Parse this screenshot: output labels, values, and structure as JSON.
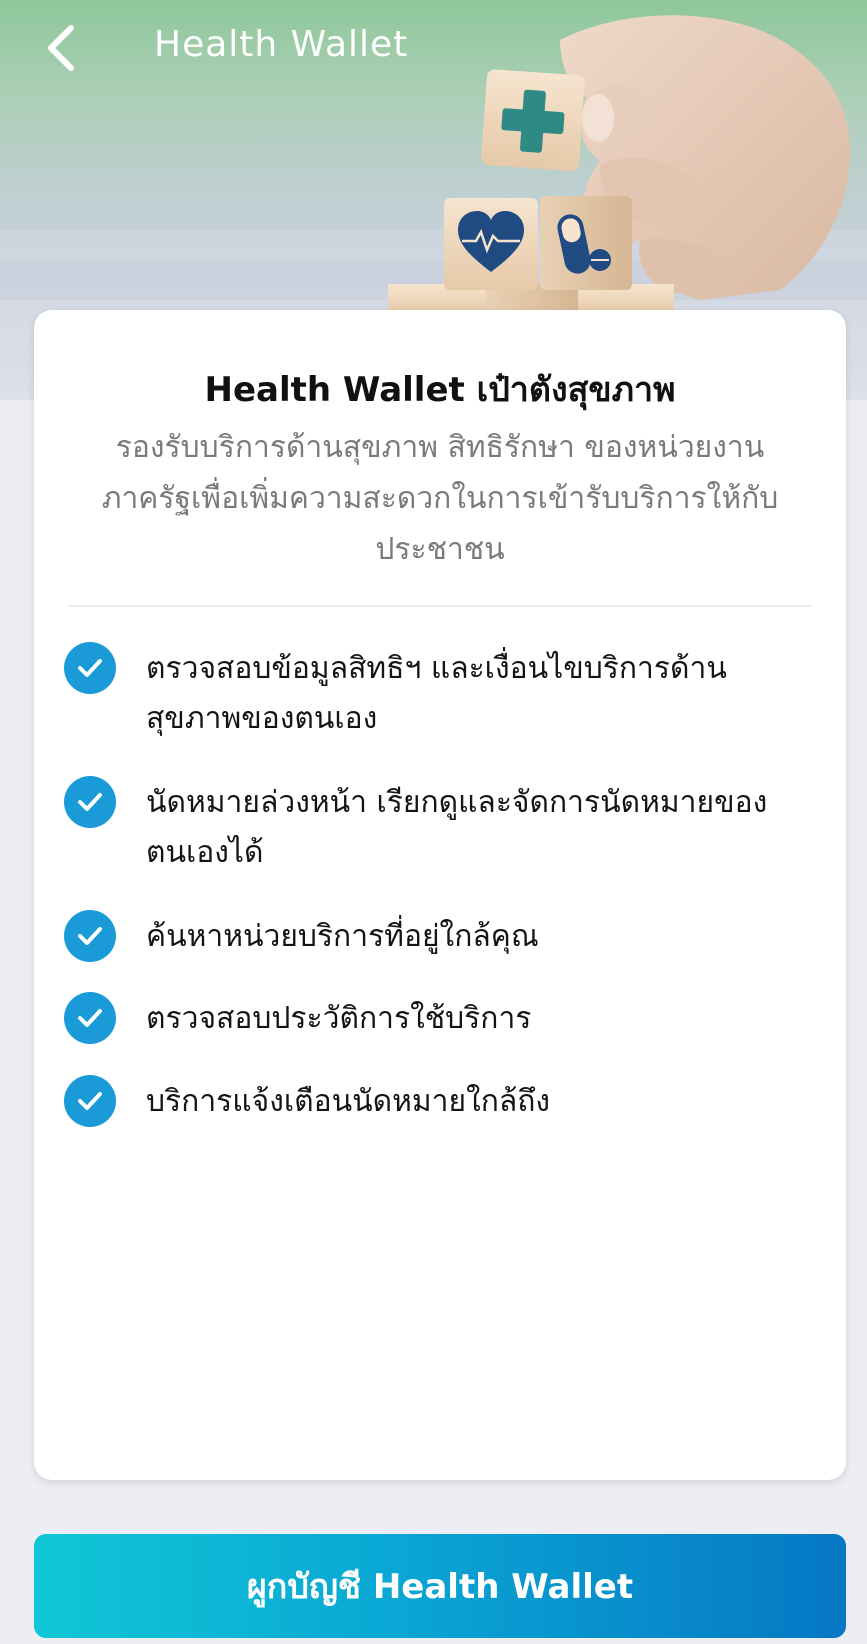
{
  "header": {
    "title": "Health Wallet",
    "back_icon": "chevron-left-icon"
  },
  "card": {
    "title": "Health Wallet เป๋าตังสุขภาพ",
    "description": "รองรับบริการด้านสุขภาพ สิทธิรักษา ของหน่วยงานภาครัฐเพื่อเพิ่มความสะดวกในการเข้ารับบริการให้กับประชาชน",
    "features": [
      {
        "icon": "check-circle-icon",
        "text": "ตรวจสอบข้อมูลสิทธิฯ และเงื่อนไขบริการด้านสุขภาพของตนเอง"
      },
      {
        "icon": "check-circle-icon",
        "text": "นัดหมายล่วงหน้า เรียกดูและจัดการนัดหมายของตนเองได้"
      },
      {
        "icon": "check-circle-icon",
        "text": "ค้นหาหน่วยบริการที่อยู่ใกล้คุณ"
      },
      {
        "icon": "check-circle-icon",
        "text": "ตรวจสอบประวัติการใช้บริการ"
      },
      {
        "icon": "check-circle-icon",
        "text": "บริการแจ้งเตือนนัดหมายใกล้ถึง"
      }
    ]
  },
  "footer": {
    "button_label": "ผูกบัญชี Health Wallet"
  },
  "colors": {
    "accent": "#1a9bd7",
    "button_gradient_start": "#10c7d6",
    "button_gradient_end": "#0677c4",
    "hero_green": "#8fc79a",
    "page_background": "#edeef3"
  },
  "hero": {
    "illustration": "hand-placing-medical-blocks-image",
    "block_icons": [
      "plus-cross-icon",
      "heart-pulse-icon",
      "pill-icon"
    ]
  }
}
